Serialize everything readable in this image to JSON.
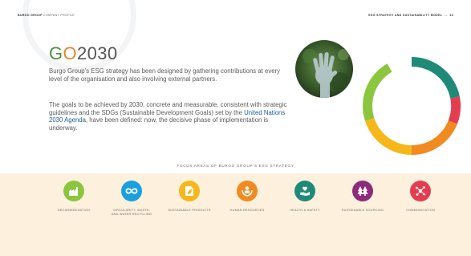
{
  "header": {
    "brand": "BURGO GROUP",
    "brand_suffix": "COMPANY PROFILE",
    "section": "ESG STRATEGY AND SUSTAINABILITY MODEL",
    "separator": "—",
    "page_number": "33"
  },
  "title": {
    "go": "GO",
    "year": "2030"
  },
  "paragraphs": {
    "intro": "Burgo Group’s ESG strategy has been designed by gathering contributions at every level of the organisation and also involving external partners.",
    "goals_before_link": "The goals to be achieved by 2030, concrete and measurable, consistent with strategic guidelines and the SDGs (Sustainable Development Goals) set by the ",
    "goals_link": "United Nations 2030 Agenda",
    "goals_after_link": ", have been defined: now, the decisive phase of implementation is underway."
  },
  "focus": {
    "title": "FOCUS AREAS OF BURGO GROUP’S ESG STRATEGY",
    "areas": [
      {
        "label_line1": "DECARBONISATION",
        "label_line2": "",
        "color": "#8cc63f",
        "icon": "factory-icon"
      },
      {
        "label_line1": "CIRCULARITY, WASTE,",
        "label_line2": "AND WATER RECYCLING",
        "color": "#1aa0dc",
        "icon": "infinity-icon"
      },
      {
        "label_line1": "SUSTAINABLE PRODUCTS",
        "label_line2": "",
        "color": "#f6b71b",
        "icon": "document-leaf-icon"
      },
      {
        "label_line1": "HUMAN RESOURCES",
        "label_line2": "",
        "color": "#f18a21",
        "icon": "people-hands-icon"
      },
      {
        "label_line1": "HEALTH & SAFETY",
        "label_line2": "",
        "color": "#1f8a78",
        "icon": "hand-heart-icon"
      },
      {
        "label_line1": "SUSTAINABLE SOURCING",
        "label_line2": "",
        "color": "#8e2a7b",
        "icon": "trees-icon"
      },
      {
        "label_line1": "COMMUNICATION",
        "label_line2": "",
        "color": "#e43d4f",
        "icon": "network-icon"
      }
    ]
  },
  "colors": {
    "link": "#1d5d9c",
    "cream_band": "#fdf1dd",
    "donut": [
      "#1f8a78",
      "#8cc63f",
      "#f6b71b",
      "#f18a21",
      "#e43d4f"
    ]
  }
}
